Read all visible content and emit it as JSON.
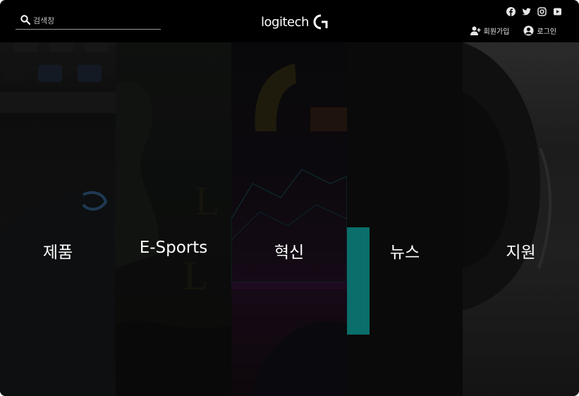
{
  "search": {
    "placeholder": "검색창",
    "icon": "search-icon"
  },
  "brand": {
    "logo_text": "logitech",
    "logo_mark": "logitech-g-icon"
  },
  "social": [
    "facebook-icon",
    "twitter-icon",
    "instagram-icon",
    "youtube-icon"
  ],
  "account": {
    "signup_label": "회원가입",
    "login_label": "로그인"
  },
  "panels": [
    {
      "label": "제품"
    },
    {
      "label": "E-Sports"
    },
    {
      "label": "혁신"
    },
    {
      "label": "뉴스"
    },
    {
      "label": "지원"
    }
  ],
  "colors": {
    "background": "#000000",
    "accent": "#0a6e6a",
    "text": "#ffffff"
  }
}
